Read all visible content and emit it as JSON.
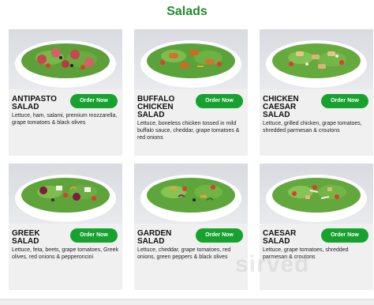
{
  "header": {
    "title": "Salads"
  },
  "brand": {
    "accent": "#1f8a2c",
    "button_color": "#17a22f"
  },
  "salads": [
    {
      "name": "ANTIPASTO SALAD",
      "button": "Order Now",
      "description": "Lettuce, ham, salami, premium mozzarella, grape tomatoes & black olives"
    },
    {
      "name": "BUFFALO CHICKEN SALAD",
      "button": "Order Now",
      "description": "Lettuce, boneless chicken tossed in mild buffalo sauce, cheddar, grape tomatoes & red onions"
    },
    {
      "name": "CHICKEN CAESAR SALAD",
      "button": "Order Now",
      "description": "Lettuce, grilled chicken, grape tomatoes, shredded parmesan & croutons"
    },
    {
      "name": "GREEK SALAD",
      "button": "Order Now",
      "description": "Lettuce, feta, beets, grape tomatoes, Greek olives, red onions & pepperoncini"
    },
    {
      "name": "GARDEN SALAD",
      "button": "Order Now",
      "description": "Lettuce, cheddar, grape tomatoes, red onions, green peppers & black olives"
    },
    {
      "name": "CAESAR SALAD",
      "button": "Order Now",
      "description": "Lettuce, grape tomatoes, shredded parmesan & croutons"
    }
  ],
  "watermark": "sirved"
}
